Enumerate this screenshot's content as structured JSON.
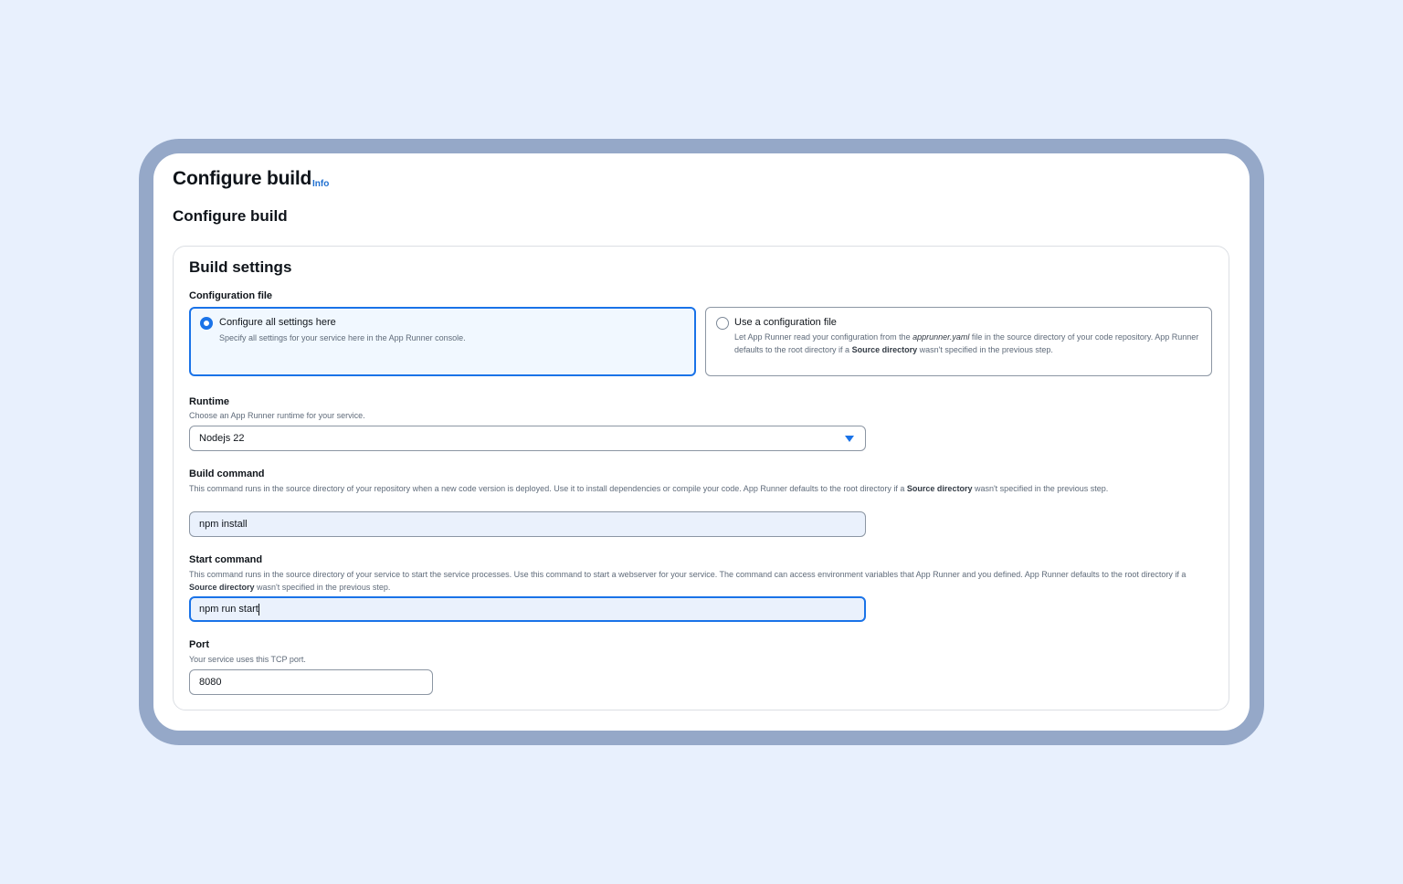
{
  "page": {
    "title": "Configure build",
    "info_link": "Info",
    "section_title": "Configure build"
  },
  "build_settings": {
    "title": "Build settings",
    "configuration_file": {
      "label": "Configuration file",
      "options": [
        {
          "title": "Configure all settings here",
          "description": "Specify all settings for your service here in the App Runner console.",
          "selected": true
        },
        {
          "title": "Use a configuration file",
          "description_part1": "Let App Runner read your configuration from the ",
          "description_file": "apprunner.yaml",
          "description_part2": " file in the source directory of your code repository. App Runner defaults to the root directory if a ",
          "description_bold": "Source directory",
          "description_part3": " wasn't specified in the previous step.",
          "selected": false
        }
      ]
    },
    "runtime": {
      "label": "Runtime",
      "description": "Choose an App Runner runtime for your service.",
      "value": "Nodejs 22"
    },
    "build_command": {
      "label": "Build command",
      "description_part1": "This command runs in the source directory of your repository when a new code version is deployed. Use it to install dependencies or compile your code. App Runner defaults to the root directory if a ",
      "description_bold": "Source directory",
      "description_part2": " wasn't specified in the previous step.",
      "value": "npm install"
    },
    "start_command": {
      "label": "Start command",
      "description_part1": "This command runs in the source directory of your service to start the service processes. Use this command to start a webserver for your service. The command can access environment variables that App Runner and you defined. App Runner defaults to the root directory if a ",
      "description_bold": "Source directory",
      "description_part2": " wasn't specified in the previous step.",
      "value": "npm run start"
    },
    "port": {
      "label": "Port",
      "description": "Your service uses this TCP port.",
      "value": "8080"
    }
  },
  "colors": {
    "accent": "#1a73e8",
    "background": "#e8f0fd",
    "frame": "#95a8c8"
  }
}
